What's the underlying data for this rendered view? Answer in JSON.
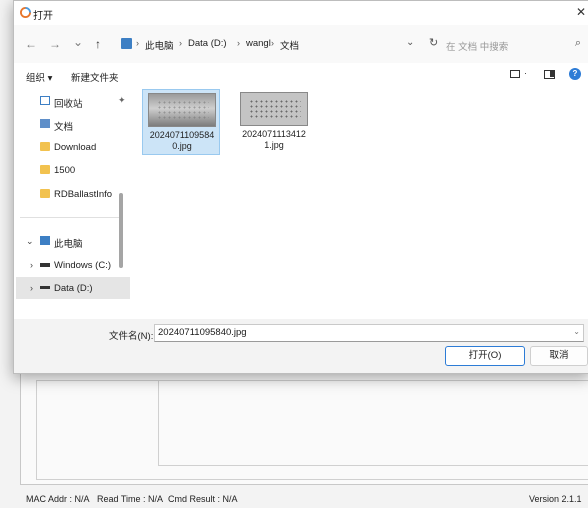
{
  "dialog": {
    "title": "打开",
    "close_icon": "close-icon"
  },
  "nav": {
    "back": "←",
    "forward": "→",
    "recent": "⌄",
    "up": "↑",
    "breadcrumb": [
      "此电脑",
      "Data (D:)",
      "wangl",
      "文档"
    ],
    "separator": "›",
    "search_placeholder": "在 文档 中搜索"
  },
  "toolbar": {
    "organize": "组织 ▾",
    "new_folder": "新建文件夹"
  },
  "sidebar": {
    "items": [
      {
        "label": "回收站",
        "icon": "recycle-bin-icon"
      },
      {
        "label": "文档",
        "icon": "documents-icon"
      },
      {
        "label": "Download",
        "icon": "folder-icon"
      },
      {
        "label": "1500",
        "icon": "folder-icon"
      },
      {
        "label": "RDBallastInfo",
        "icon": "folder-icon"
      }
    ],
    "this_pc": "此电脑",
    "drives": [
      {
        "label": "Windows (C:)",
        "icon": "drive-icon"
      },
      {
        "label": "Data (D:)",
        "icon": "drive-icon"
      }
    ]
  },
  "files": [
    {
      "name": "20240711095840.jpg",
      "name_display": "2024071109584\n0.jpg",
      "selected": true
    },
    {
      "name": "20240711134121.jpg",
      "name_display": "2024071113412\n1.jpg",
      "selected": false
    }
  ],
  "bottom": {
    "filename_label": "文件名(N):",
    "filename_value": "20240711095840.jpg",
    "open_label": "打开(O)",
    "cancel_label": "取消"
  },
  "status": {
    "mac": "MAC Addr : N/A",
    "read_time": "Read Time : N/A",
    "cmd_result": "Cmd Result : N/A",
    "version": "Version  2.1.1"
  }
}
